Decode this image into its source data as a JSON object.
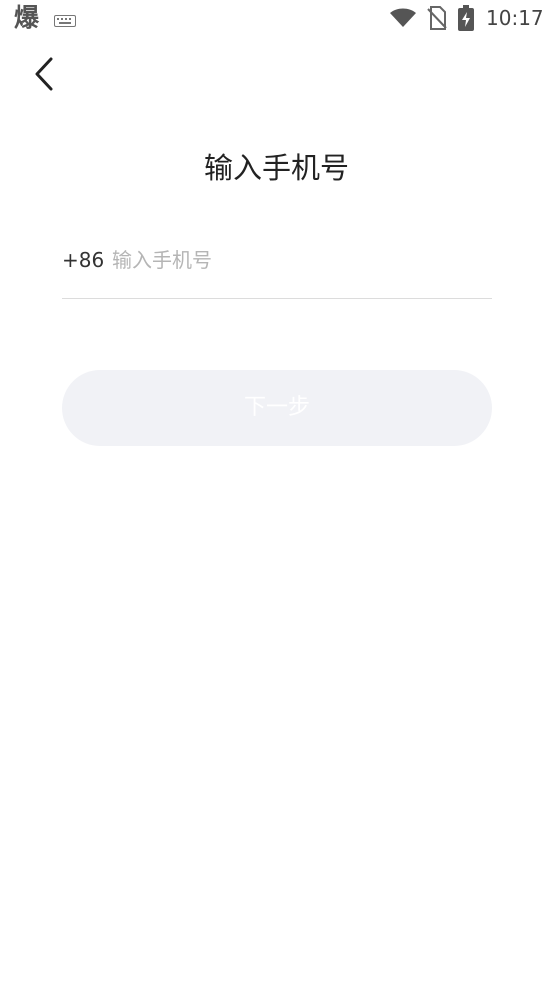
{
  "status_bar": {
    "app_glyph": "爆",
    "time": "10:17",
    "icons": [
      "keyboard-icon",
      "wifi-icon",
      "no-sim-icon",
      "battery-charging-icon"
    ]
  },
  "header": {
    "back_icon": "chevron-left-icon",
    "title": "输入手机号"
  },
  "phone_form": {
    "country_code": "+86",
    "input_value": "",
    "placeholder": "输入手机号"
  },
  "next_button": {
    "label": "下一步",
    "enabled": false
  },
  "colors": {
    "button_bg_disabled": "#f1f2f6",
    "button_text_disabled": "#ffffff",
    "divider": "#dcdcdc",
    "placeholder": "#b5b5b5",
    "title_text": "#222222"
  }
}
